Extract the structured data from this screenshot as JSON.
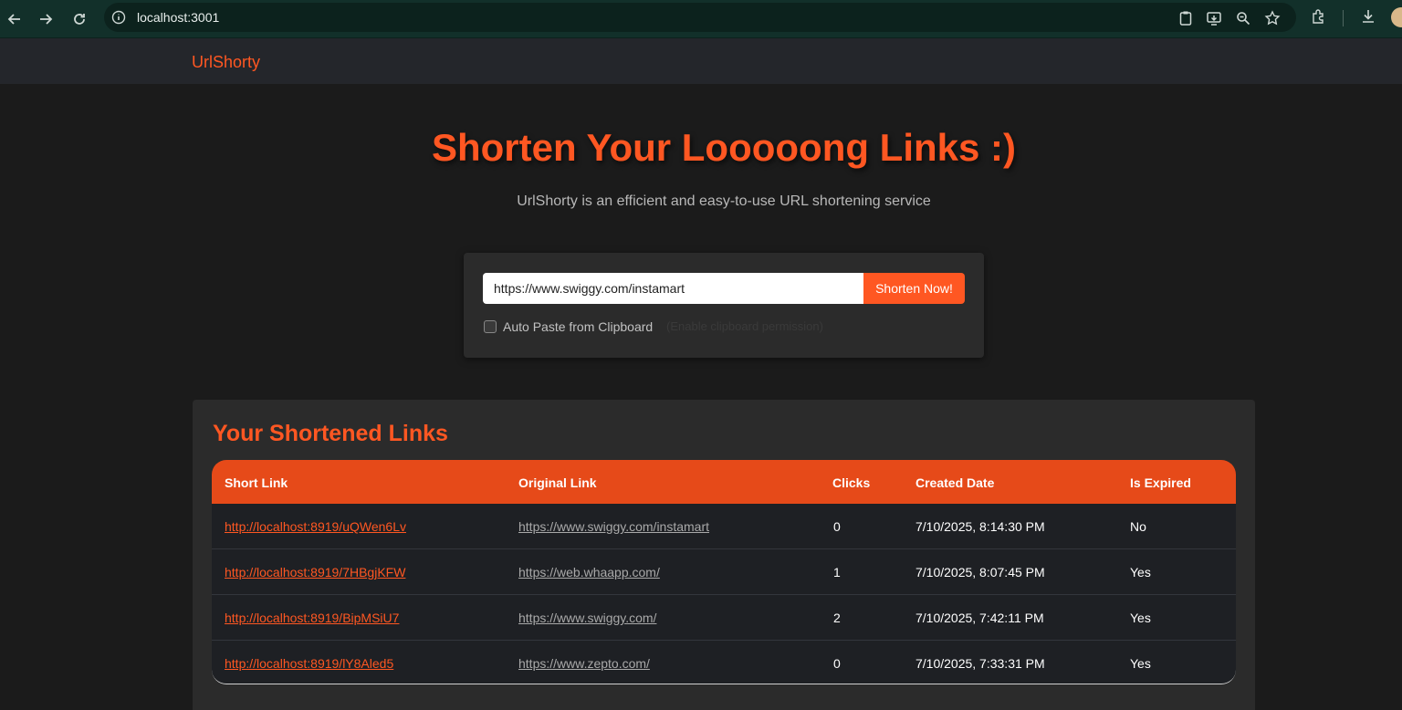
{
  "browser": {
    "url": "localhost:3001"
  },
  "app": {
    "brand": "UrlShorty"
  },
  "hero": {
    "title": "Shorten Your Looooong Links :)",
    "subtitle": "UrlShorty is an efficient and easy-to-use URL shortening service"
  },
  "form": {
    "url_value": "https://www.swiggy.com/instamart",
    "button_label": "Shorten Now!",
    "auto_paste_label": "Auto Paste from Clipboard",
    "auto_paste_checked": false,
    "hint": "(Enable clipboard permission)"
  },
  "links": {
    "title": "Your Shortened Links",
    "headers": [
      "Short Link",
      "Original Link",
      "Clicks",
      "Created Date",
      "Is Expired"
    ],
    "rows": [
      {
        "short": "http://localhost:8919/uQWen6Lv",
        "original": "https://www.swiggy.com/instamart",
        "clicks": "0",
        "created": "7/10/2025, 8:14:30 PM",
        "expired": "No"
      },
      {
        "short": "http://localhost:8919/7HBgjKFW",
        "original": "https://web.whaapp.com/",
        "clicks": "1",
        "created": "7/10/2025, 8:07:45 PM",
        "expired": "Yes"
      },
      {
        "short": "http://localhost:8919/BipMSiU7",
        "original": "https://www.swiggy.com/",
        "clicks": "2",
        "created": "7/10/2025, 7:42:11 PM",
        "expired": "Yes"
      },
      {
        "short": "http://localhost:8919/lY8Aled5",
        "original": "https://www.zepto.com/",
        "clicks": "0",
        "created": "7/10/2025, 7:33:31 PM",
        "expired": "Yes"
      }
    ]
  },
  "colors": {
    "accent": "#ff5722",
    "header": "#e64a19",
    "background": "#1b1b1b"
  }
}
